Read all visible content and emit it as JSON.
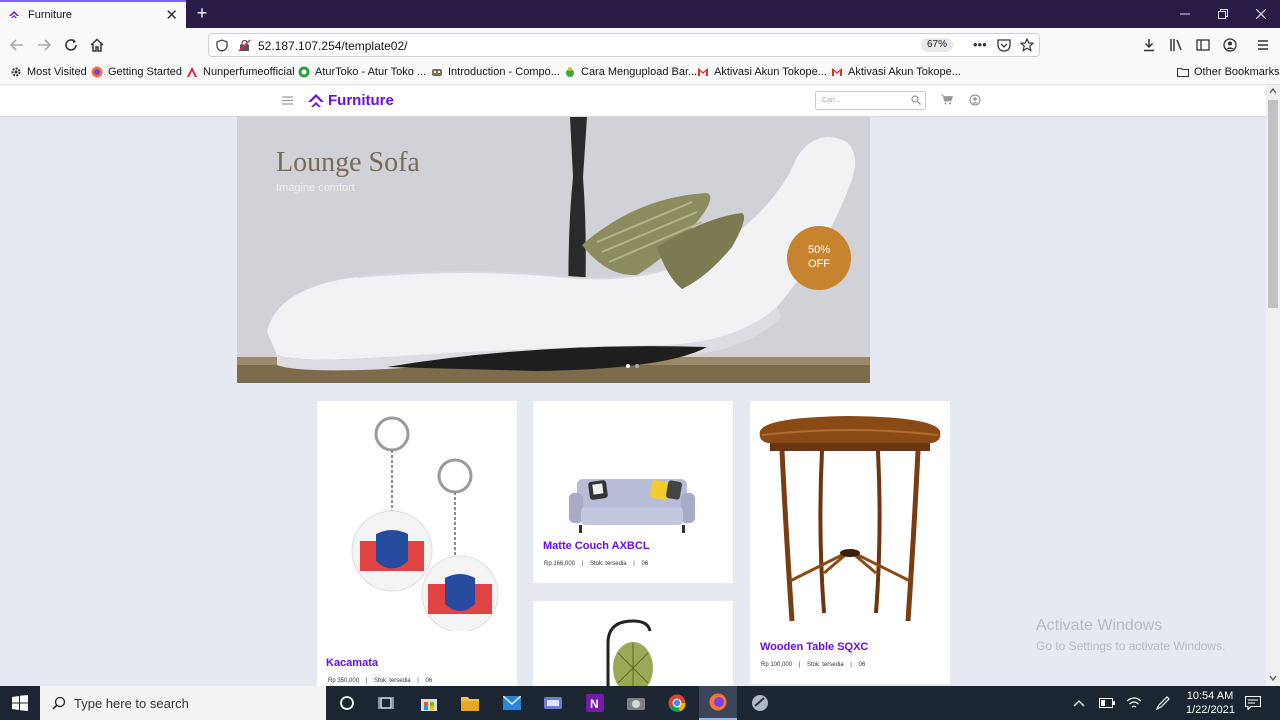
{
  "browser": {
    "tab_title": "Furniture",
    "tab_close": "✕",
    "new_tab": "+",
    "url": "52.187.107.254/template02/",
    "zoom": "67%",
    "page_actions": "•••",
    "bookmarks": [
      {
        "label": "Most Visited",
        "icon": "gear-icon"
      },
      {
        "label": "Getting Started",
        "icon": "firefox-icon"
      },
      {
        "label": "Nunperfumeofficial",
        "icon": "red-logo-icon"
      },
      {
        "label": "AturToko - Atur Toko ...",
        "icon": "green-globe-icon"
      },
      {
        "label": "Introduction - Compo...",
        "icon": "bookmark-icon"
      },
      {
        "label": "Cara Mengupload Bar...",
        "icon": "bug-icon"
      },
      {
        "label": "Aktivasi Akun Tokope...",
        "icon": "gmail-icon"
      },
      {
        "label": "Aktivasi Akun Tokope...",
        "icon": "gmail-icon"
      }
    ],
    "other_bookmarks": "Other Bookmarks"
  },
  "site": {
    "brand": "Furniture",
    "brand_color": "#6a0fe0",
    "search_placeholder": "Cari...",
    "hero": {
      "title": "Lounge Sofa",
      "subtitle": "Imagine comfort",
      "badge_line1": "50%",
      "badge_line2": "OFF",
      "slide_index": 1,
      "slide_count": 2
    },
    "products": [
      {
        "name": "Kacamata",
        "price": "Rp 350,000",
        "stock": "Stok: tersedia",
        "qty": "06"
      },
      {
        "name": "Matte Couch AXBCL",
        "price": "Rp 166,000",
        "stock": "Stok: tersedia",
        "qty": "06"
      },
      {
        "name": "Wooden Table SQXC",
        "price": "Rp 100,000",
        "stock": "Stok: tersedia",
        "qty": "06"
      }
    ],
    "separator": "|"
  },
  "watermark": {
    "line1": "Activate Windows",
    "line2": "Go to Settings to activate Windows."
  },
  "taskbar": {
    "search_placeholder": "Type here to search",
    "time": "10:54 AM",
    "date": "1/22/2021"
  }
}
